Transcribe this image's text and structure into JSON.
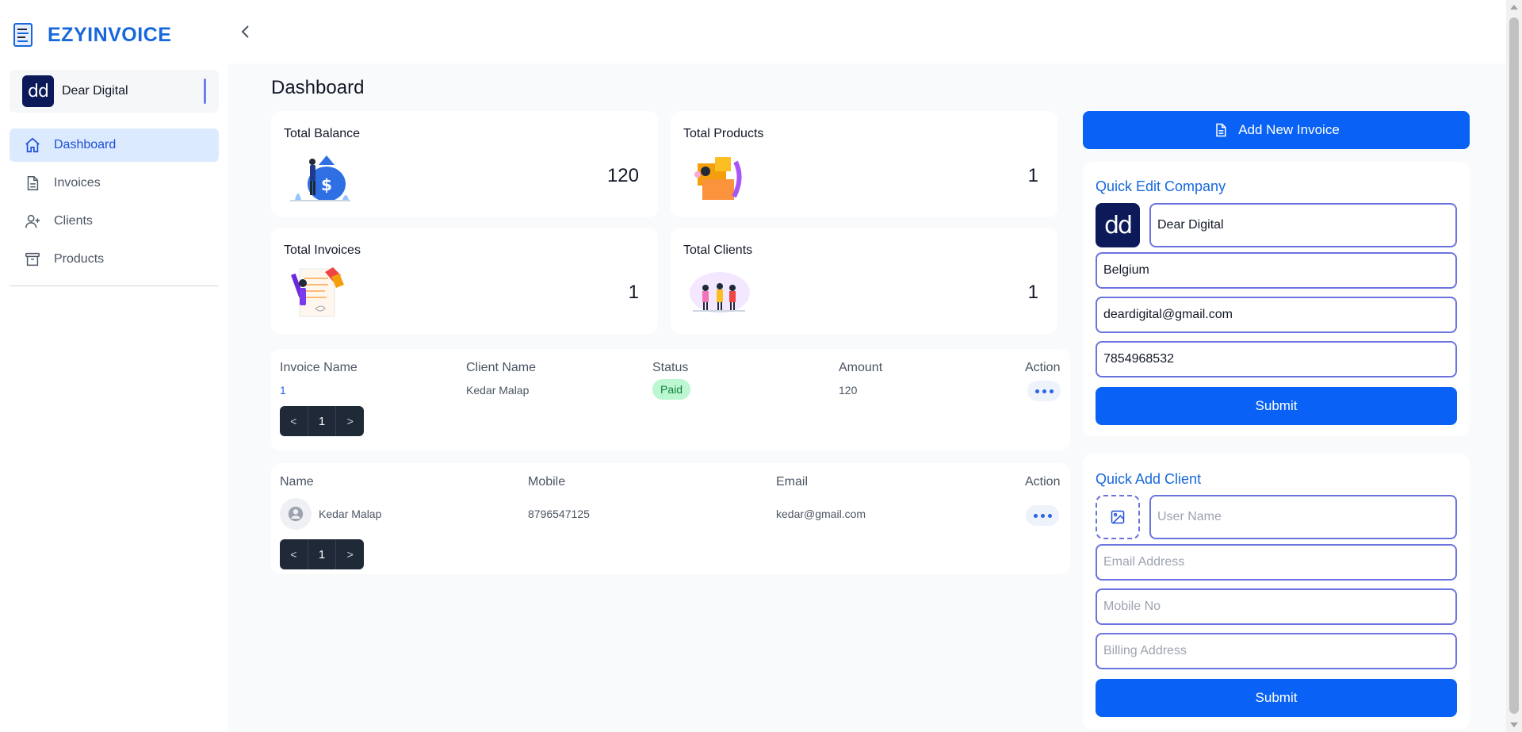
{
  "brand": {
    "name": "EZYINVOICE"
  },
  "company": {
    "avatar_text": "dd",
    "name": "Dear Digital"
  },
  "nav": [
    {
      "label": "Dashboard",
      "icon": "home-icon",
      "active": true
    },
    {
      "label": "Invoices",
      "icon": "document-icon",
      "active": false
    },
    {
      "label": "Clients",
      "icon": "user-plus-icon",
      "active": false
    },
    {
      "label": "Products",
      "icon": "archive-icon",
      "active": false
    }
  ],
  "page": {
    "title": "Dashboard"
  },
  "stats": [
    {
      "label": "Total Balance",
      "value": "120",
      "illustration": "money-bag-illustration"
    },
    {
      "label": "Total Products",
      "value": "1",
      "illustration": "boxes-illustration"
    },
    {
      "label": "Total Invoices",
      "value": "1",
      "illustration": "document-writing-illustration"
    },
    {
      "label": "Total Clients",
      "value": "1",
      "illustration": "people-illustration"
    }
  ],
  "invoice_table": {
    "headers": [
      "Invoice Name",
      "Client Name",
      "Status",
      "Amount",
      "Action"
    ],
    "rows": [
      {
        "invoice_name": "1",
        "client_name": "Kedar Malap",
        "status": "Paid",
        "amount": "120"
      }
    ],
    "pager": {
      "prev": "<",
      "page": "1",
      "next": ">"
    }
  },
  "client_table": {
    "headers": [
      "Name",
      "Mobile",
      "Email",
      "Action"
    ],
    "rows": [
      {
        "name": "Kedar Malap",
        "mobile": "8796547125",
        "email": "kedar@gmail.com"
      }
    ],
    "pager": {
      "prev": "<",
      "page": "1",
      "next": ">"
    }
  },
  "add_invoice": {
    "label": "Add New Invoice"
  },
  "quick_edit": {
    "title": "Quick Edit Company",
    "avatar_text": "dd",
    "company_name": "Dear Digital",
    "country": "Belgium",
    "email": "deardigital@gmail.com",
    "phone": "7854968532",
    "submit_label": "Submit"
  },
  "quick_add": {
    "title": "Quick Add Client",
    "username_placeholder": "User Name",
    "email_placeholder": "Email Address",
    "mobile_placeholder": "Mobile No",
    "billing_placeholder": "Billing Address",
    "submit_label": "Submit"
  },
  "colors": {
    "accent": "#0962f5",
    "brand": "#1668dc",
    "avatar_bg": "#0c1a5a",
    "paid_bg": "#bbf7d0",
    "paid_text": "#15803d"
  }
}
